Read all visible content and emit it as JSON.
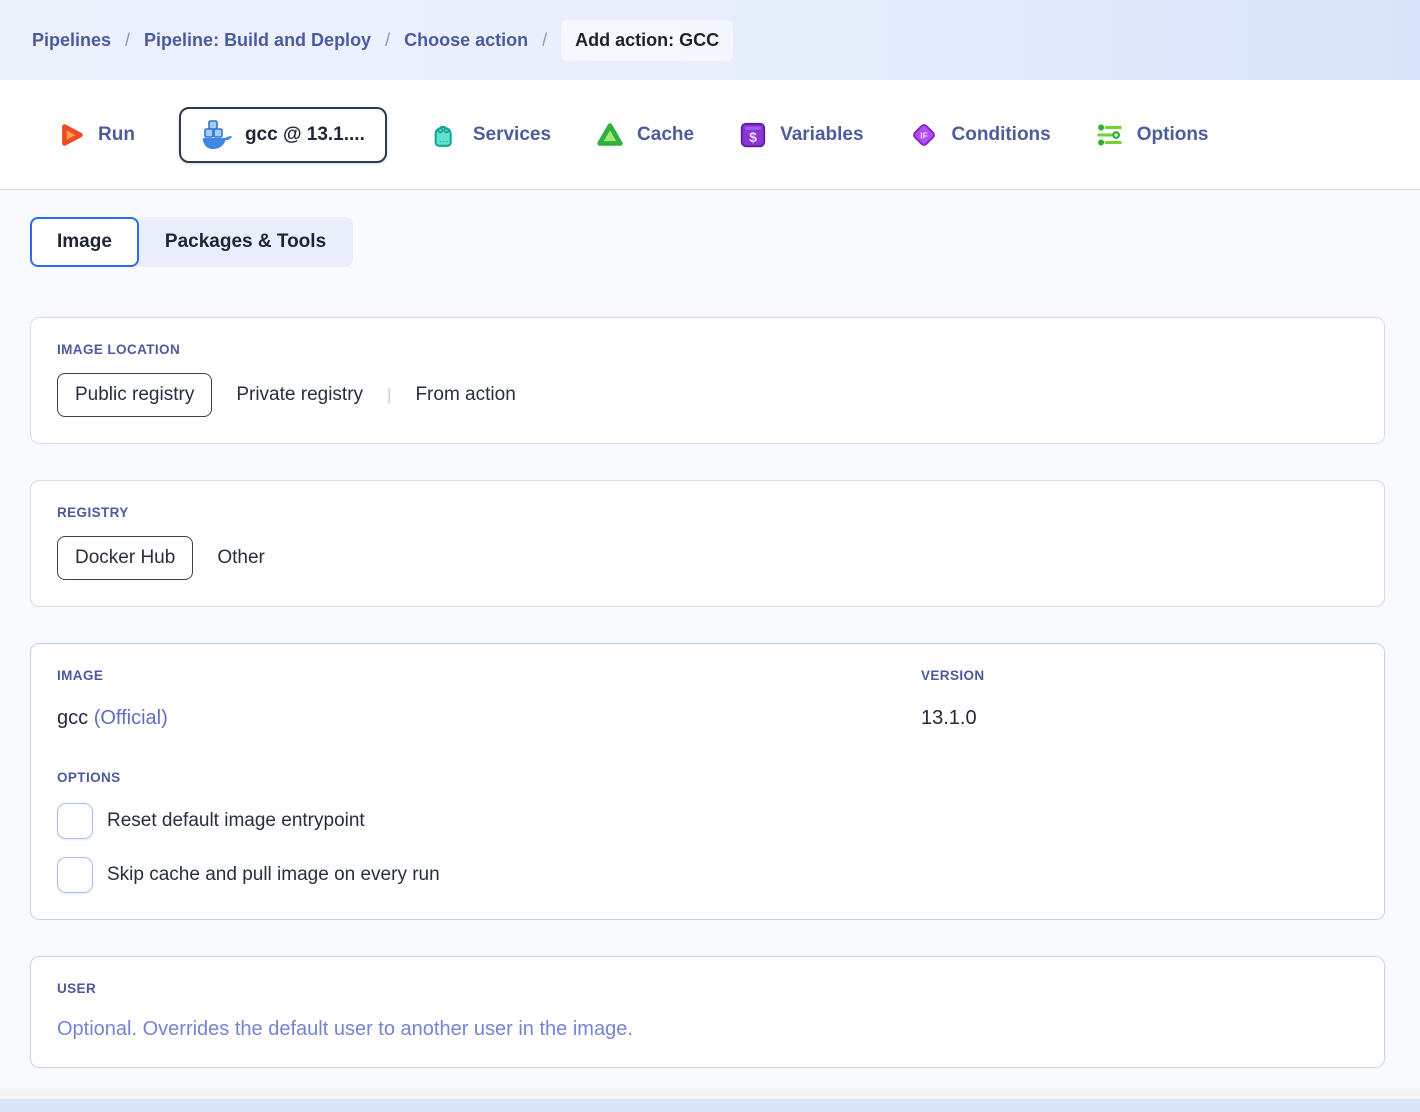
{
  "header": {
    "breadcrumb": {
      "separator": "/",
      "links": [
        "Pipelines",
        "Pipeline: Build and Deploy",
        "Choose action"
      ],
      "current": "Add action: GCC"
    }
  },
  "toolbar": {
    "tabs": [
      {
        "label": "Run",
        "icon": "run-play-icon",
        "active": false
      },
      {
        "label": "gcc @ 13.1....",
        "icon": "docker-whale-icon",
        "active": true
      },
      {
        "label": "Services",
        "icon": "services-bag-icon",
        "active": false
      },
      {
        "label": "Cache",
        "icon": "cache-triangle-icon",
        "active": false
      },
      {
        "label": "Variables",
        "icon": "variables-dollar-icon",
        "active": false
      },
      {
        "label": "Conditions",
        "icon": "conditions-if-icon",
        "active": false
      },
      {
        "label": "Options",
        "icon": "options-sliders-icon",
        "active": false
      }
    ]
  },
  "view_tabs": {
    "tabs": [
      {
        "label": "Image",
        "active": true
      },
      {
        "label": "Packages & Tools",
        "active": false
      }
    ]
  },
  "image_location": {
    "label": "IMAGE LOCATION",
    "divider": "|",
    "options": [
      {
        "label": "Public registry",
        "selected": true
      },
      {
        "label": "Private registry",
        "selected": false
      },
      {
        "label": "From action",
        "selected": false
      }
    ]
  },
  "registry": {
    "label": "REGISTRY",
    "options": [
      {
        "label": "Docker Hub",
        "selected": true
      },
      {
        "label": "Other",
        "selected": false
      }
    ]
  },
  "image_card": {
    "image_label": "IMAGE",
    "image_name": "gcc",
    "image_badge": "(Official)",
    "version_label": "VERSION",
    "version_value": "13.1.0",
    "options_label": "OPTIONS",
    "checkboxes": [
      {
        "label": "Reset default image entrypoint",
        "checked": false
      },
      {
        "label": "Skip cache and pull image on every run",
        "checked": false
      }
    ]
  },
  "user_card": {
    "label": "USER",
    "placeholder": "Optional. Overrides the default user to another user in the image."
  },
  "colors": {
    "accent_blue": "#2b6ce8",
    "breadcrumb_link": "#4c5b9e",
    "header_bg": "#e9effc",
    "run_orange": "#ee4b26",
    "docker_blue": "#3e89e3",
    "services_teal": "#3fd6c4",
    "cache_green": "#35b24a",
    "variables_purple": "#8b33d6",
    "conditions_purple": "#a94fe8",
    "options_green": "#4fc434",
    "placeholder_indigo": "#7584d2"
  }
}
